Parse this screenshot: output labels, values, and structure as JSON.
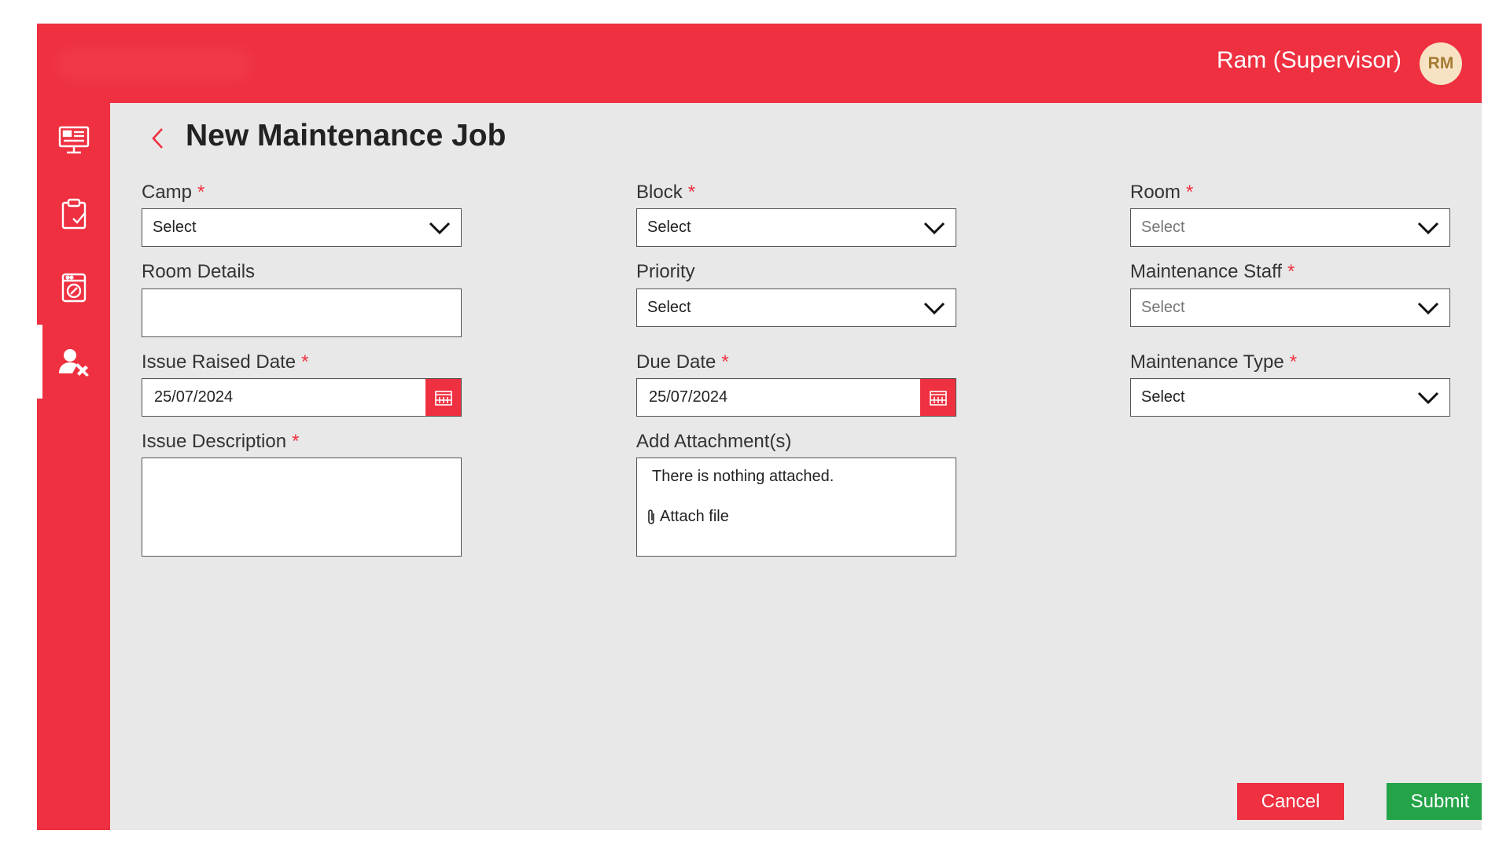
{
  "header": {
    "user_name": "Ram (Supervisor)",
    "avatar_initials": "RM"
  },
  "sidebar": {
    "items": [
      {
        "icon": "dashboard-monitor-icon",
        "active": false
      },
      {
        "icon": "clipboard-check-icon",
        "active": false
      },
      {
        "icon": "washing-machine-icon",
        "active": false
      },
      {
        "icon": "user-maintenance-icon",
        "active": true
      }
    ]
  },
  "page": {
    "title": "New Maintenance Job",
    "back_icon": "chevron-left-icon"
  },
  "form": {
    "required_mark": "*",
    "camp": {
      "label": "Camp",
      "value": "Select"
    },
    "block": {
      "label": "Block",
      "value": "Select"
    },
    "room": {
      "label": "Room",
      "value": "Select"
    },
    "room_details": {
      "label": "Room Details",
      "value": ""
    },
    "priority": {
      "label": "Priority",
      "value": "Select"
    },
    "maintenance_staff": {
      "label": "Maintenance Staff",
      "value": "Select"
    },
    "issue_raised_date": {
      "label": "Issue Raised Date",
      "value": "25/07/2024"
    },
    "due_date": {
      "label": "Due Date",
      "value": "25/07/2024"
    },
    "maintenance_type": {
      "label": "Maintenance Type",
      "value": "Select"
    },
    "issue_description": {
      "label": "Issue Description",
      "value": ""
    },
    "attachments": {
      "label": "Add Attachment(s)",
      "empty_text": "There is nothing attached.",
      "attach_label": "Attach file"
    }
  },
  "actions": {
    "cancel_label": "Cancel",
    "submit_label": "Submit"
  },
  "colors": {
    "brand_red": "#ee3040",
    "submit_green": "#24a349",
    "background": "#e8e8e8",
    "avatar_bg": "#f7e3c4"
  }
}
